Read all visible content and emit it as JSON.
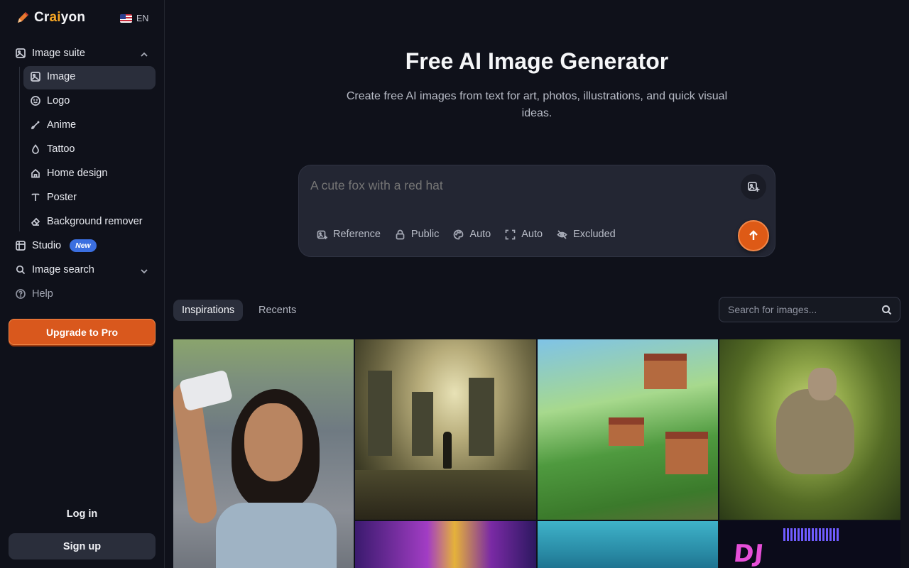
{
  "brand": {
    "prefix": "Cr",
    "accent": "ai",
    "suffix": "yon",
    "language": "EN"
  },
  "sidebar": {
    "image_suite": {
      "label": "Image suite"
    },
    "items": [
      {
        "label": "Image",
        "icon": "image-icon",
        "active": true
      },
      {
        "label": "Logo",
        "icon": "smile-icon"
      },
      {
        "label": "Anime",
        "icon": "brush-icon"
      },
      {
        "label": "Tattoo",
        "icon": "drop-icon"
      },
      {
        "label": "Home design",
        "icon": "home-icon"
      },
      {
        "label": "Poster",
        "icon": "text-icon"
      },
      {
        "label": "Background remover",
        "icon": "eraser-icon"
      }
    ],
    "studio": {
      "label": "Studio",
      "badge": "New"
    },
    "image_search": {
      "label": "Image search"
    },
    "help": {
      "label": "Help"
    },
    "upgrade_label": "Upgrade to Pro",
    "login_label": "Log in",
    "signup_label": "Sign up"
  },
  "hero": {
    "title": "Free AI Image Generator",
    "subtitle": "Create free AI images from text for art, photos, illustrations, and quick visual ideas."
  },
  "prompt": {
    "placeholder": "A cute fox with a red hat",
    "options": [
      {
        "label": "Reference",
        "icon": "reference-icon"
      },
      {
        "label": "Public",
        "icon": "lock-icon"
      },
      {
        "label": "Auto",
        "icon": "palette-icon"
      },
      {
        "label": "Auto",
        "icon": "aspect-ratio-icon"
      },
      {
        "label": "Excluded",
        "icon": "eye-off-icon"
      }
    ]
  },
  "gallery": {
    "tabs": [
      {
        "label": "Inspirations",
        "active": true
      },
      {
        "label": "Recents",
        "active": false
      }
    ],
    "search_placeholder": "Search for images...",
    "tiles": [
      {
        "name": "tile-selfie-woman"
      },
      {
        "name": "tile-ruined-city"
      },
      {
        "name": "tile-village-totoro"
      },
      {
        "name": "tile-cat-riding-dinosaur"
      },
      {
        "name": "tile-party-hat"
      },
      {
        "name": "tile-underwater-shark"
      },
      {
        "name": "tile-dj-poster",
        "text": "DJ RUPTURE"
      }
    ]
  },
  "colors": {
    "accent_orange": "#de5a16",
    "badge_blue": "#3b6fe0",
    "background": "#0f111a"
  }
}
